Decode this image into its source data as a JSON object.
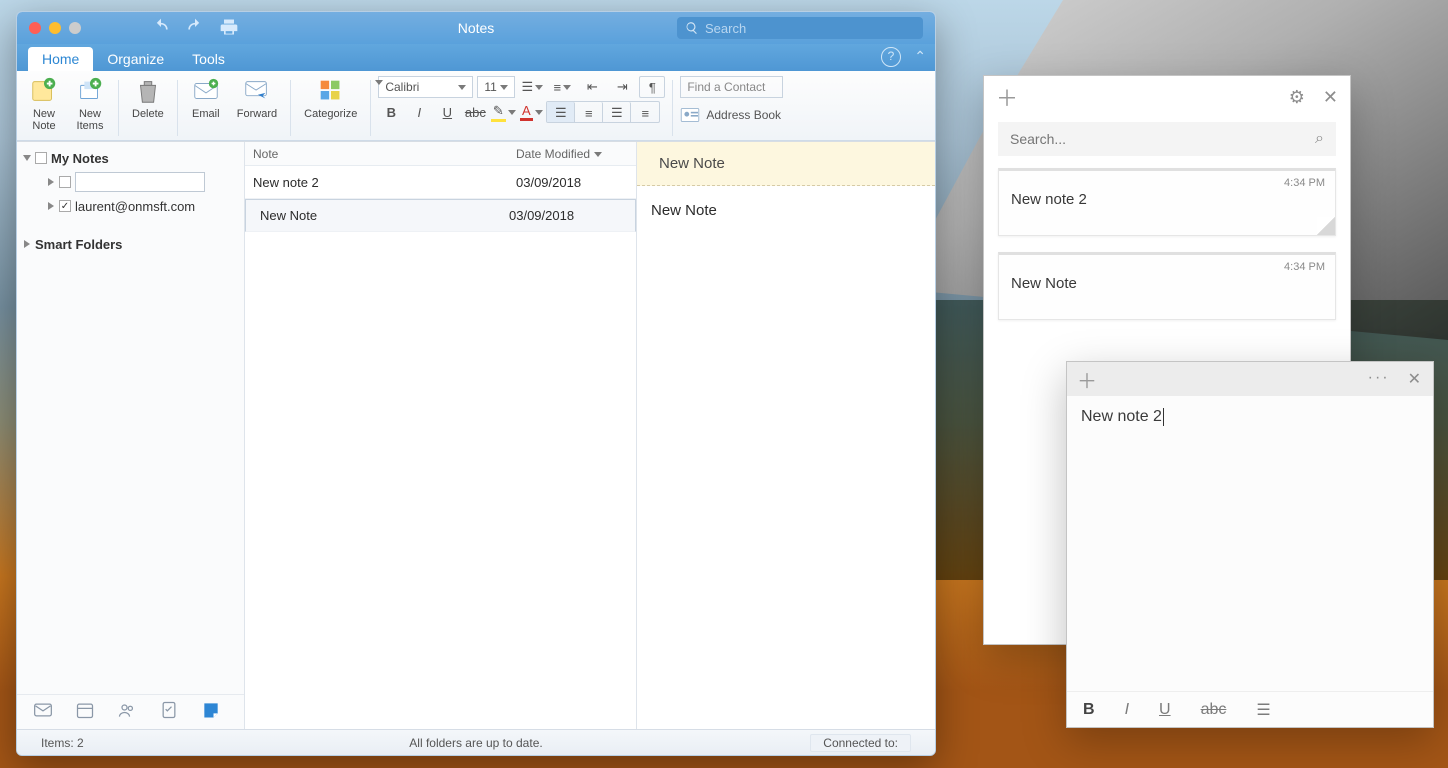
{
  "outlook": {
    "window_title": "Notes",
    "search_placeholder": "Search",
    "tabs": {
      "home": "Home",
      "organize": "Organize",
      "tools": "Tools"
    },
    "ribbon": {
      "new_note": "New\nNote",
      "new_items": "New\nItems",
      "delete": "Delete",
      "email": "Email",
      "forward": "Forward",
      "categorize": "Categorize",
      "font_name": "Calibri",
      "font_size": "11",
      "find_contact_placeholder": "Find a Contact",
      "address_book": "Address Book"
    },
    "sidebar": {
      "my_notes": "My Notes",
      "account": "laurent@onmsft.com",
      "smart_folders": "Smart Folders"
    },
    "list": {
      "col_note": "Note",
      "col_date": "Date Modified",
      "rows": [
        {
          "title": "New note 2",
          "date": "03/09/2018"
        },
        {
          "title": "New Note",
          "date": "03/09/2018"
        }
      ]
    },
    "reading": {
      "title": "New Note",
      "body": "New Note"
    },
    "status": {
      "left": "Items: 2",
      "center": "All folders are up to date.",
      "right": "Connected to:"
    }
  },
  "sticky_list": {
    "search_placeholder": "Search...",
    "cards": [
      {
        "time": "4:34 PM",
        "title": "New note 2"
      },
      {
        "time": "4:34 PM",
        "title": "New Note"
      }
    ]
  },
  "sticky_note": {
    "body": "New note 2"
  }
}
